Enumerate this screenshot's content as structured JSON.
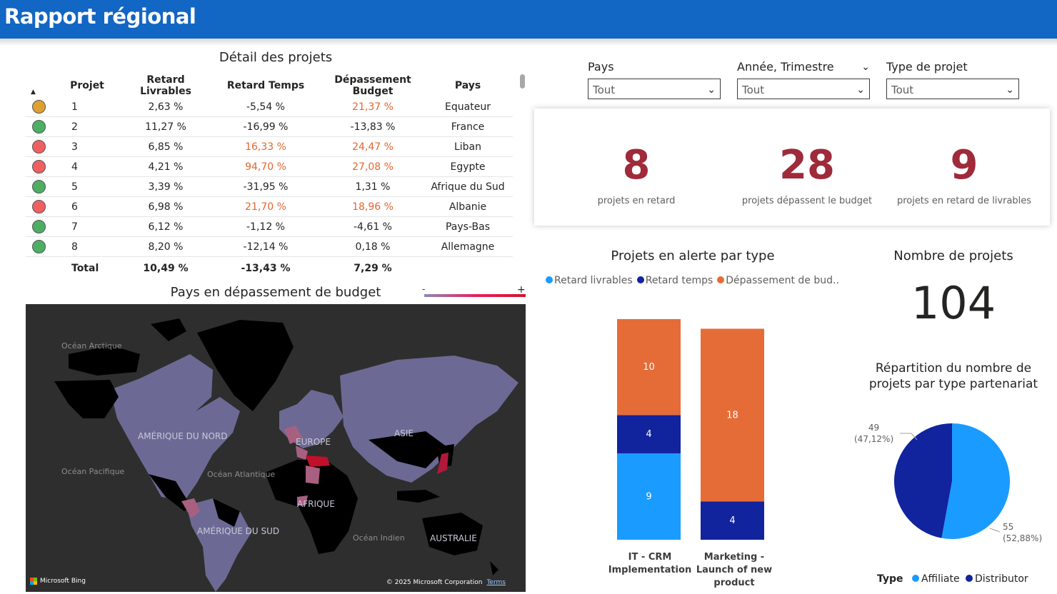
{
  "header": {
    "title": "Rapport régional"
  },
  "table": {
    "title": "Détail des projets",
    "columns": [
      "Projet",
      "Retard Livrables",
      "Retard Temps",
      "Dépassement Budget",
      "Pays"
    ],
    "rows": [
      {
        "status": "orange",
        "status_color": "#e0a030",
        "projet": "1",
        "retard_livrables": "2,63 %",
        "retard_temps": "-5,54 %",
        "depassement_budget": "21,37 %",
        "pays": "Equateur",
        "rt_red": false,
        "db_red": true
      },
      {
        "status": "green",
        "status_color": "#4caf64",
        "projet": "2",
        "retard_livrables": "11,27 %",
        "retard_temps": "-16,99 %",
        "depassement_budget": "-13,83 %",
        "pays": "France",
        "rt_red": false,
        "db_red": false
      },
      {
        "status": "red",
        "status_color": "#f06060",
        "projet": "3",
        "retard_livrables": "6,85 %",
        "retard_temps": "16,33 %",
        "depassement_budget": "24,47 %",
        "pays": "Liban",
        "rt_red": true,
        "db_red": true
      },
      {
        "status": "red",
        "status_color": "#f06060",
        "projet": "4",
        "retard_livrables": "4,21 %",
        "retard_temps": "94,70 %",
        "depassement_budget": "27,08 %",
        "pays": "Egypte",
        "rt_red": true,
        "db_red": true
      },
      {
        "status": "green",
        "status_color": "#4caf64",
        "projet": "5",
        "retard_livrables": "3,39 %",
        "retard_temps": "-31,95 %",
        "depassement_budget": "1,31 %",
        "pays": "Afrique du Sud",
        "rt_red": false,
        "db_red": false
      },
      {
        "status": "red",
        "status_color": "#f06060",
        "projet": "6",
        "retard_livrables": "6,98 %",
        "retard_temps": "21,70 %",
        "depassement_budget": "18,96 %",
        "pays": "Albanie",
        "rt_red": true,
        "db_red": true
      },
      {
        "status": "green",
        "status_color": "#4caf64",
        "projet": "7",
        "retard_livrables": "6,12 %",
        "retard_temps": "-1,12 %",
        "depassement_budget": "-4,61 %",
        "pays": "Pays-Bas",
        "rt_red": false,
        "db_red": false
      },
      {
        "status": "green",
        "status_color": "#4caf64",
        "projet": "8",
        "retard_livrables": "8,20 %",
        "retard_temps": "-12,14 %",
        "depassement_budget": "0,18 %",
        "pays": "Allemagne",
        "rt_red": false,
        "db_red": false
      }
    ],
    "total": {
      "label": "Total",
      "retard_livrables": "10,49 %",
      "retard_temps": "-13,43 %",
      "depassement_budget": "7,29 %"
    }
  },
  "map": {
    "title": "Pays en dépassement de budget",
    "legend_min": "-",
    "legend_max": "+",
    "labels": {
      "ocean_arctique": "Océan Arctique",
      "amerique_nord": "AMÉRIQUE DU NORD",
      "europe": "EUROPE",
      "asie": "ASIE",
      "ocean_pacifique": "Océan Pacifique",
      "ocean_atlantique": "Océan Atlantique",
      "afrique": "AFRIQUE",
      "amerique_sud": "AMÉRIQUE DU SUD",
      "ocean_indien": "Océan Indien",
      "australie": "AUSTRALIE"
    },
    "attribution": "Microsoft Bing",
    "copyright": "© 2025 Microsoft Corporation",
    "terms": "Terms"
  },
  "filters": [
    {
      "label": "Pays",
      "value": "Tout"
    },
    {
      "label": "Année, Trimestre",
      "value": "Tout"
    },
    {
      "label": "Type de projet",
      "value": "Tout"
    }
  ],
  "kpis": [
    {
      "value": "8",
      "label": "projets en retard"
    },
    {
      "value": "28",
      "label": "projets dépassent le budget"
    },
    {
      "value": "9",
      "label": "projets en retard de livrables"
    }
  ],
  "bar_chart": {
    "title": "Projets en alerte par type",
    "legend": [
      "Retard livrables",
      "Retard temps",
      "Dépassement de bud..."
    ]
  },
  "count": {
    "title": "Nombre de projets",
    "value": "104"
  },
  "pie": {
    "title_line1": "Répartition du nombre de",
    "title_line2": "projets par type partenariat",
    "legend_title": "Type",
    "labels": [
      {
        "value": "49",
        "pct": "(47,12%)"
      },
      {
        "value": "55",
        "pct": "(52,88%)"
      }
    ]
  },
  "chart_data": [
    {
      "type": "bar",
      "stacked": true,
      "title": "Projets en alerte par type",
      "categories": [
        "IT - CRM Implementation",
        "Marketing - Launch of new product"
      ],
      "series": [
        {
          "name": "Retard livrables",
          "color": "#1a9bff",
          "values": [
            9,
            0
          ]
        },
        {
          "name": "Retard temps",
          "color": "#12239e",
          "values": [
            4,
            4
          ]
        },
        {
          "name": "Dépassement de bud...",
          "color": "#e66c37",
          "values": [
            10,
            18
          ]
        }
      ]
    },
    {
      "type": "pie",
      "title": "Répartition du nombre de projets par type partenariat",
      "legend_title": "Type",
      "slices": [
        {
          "name": "Affiliate",
          "value": 55,
          "percent": 52.88,
          "color": "#1a9bff"
        },
        {
          "name": "Distributor",
          "value": 49,
          "percent": 47.12,
          "color": "#12239e"
        }
      ]
    }
  ]
}
